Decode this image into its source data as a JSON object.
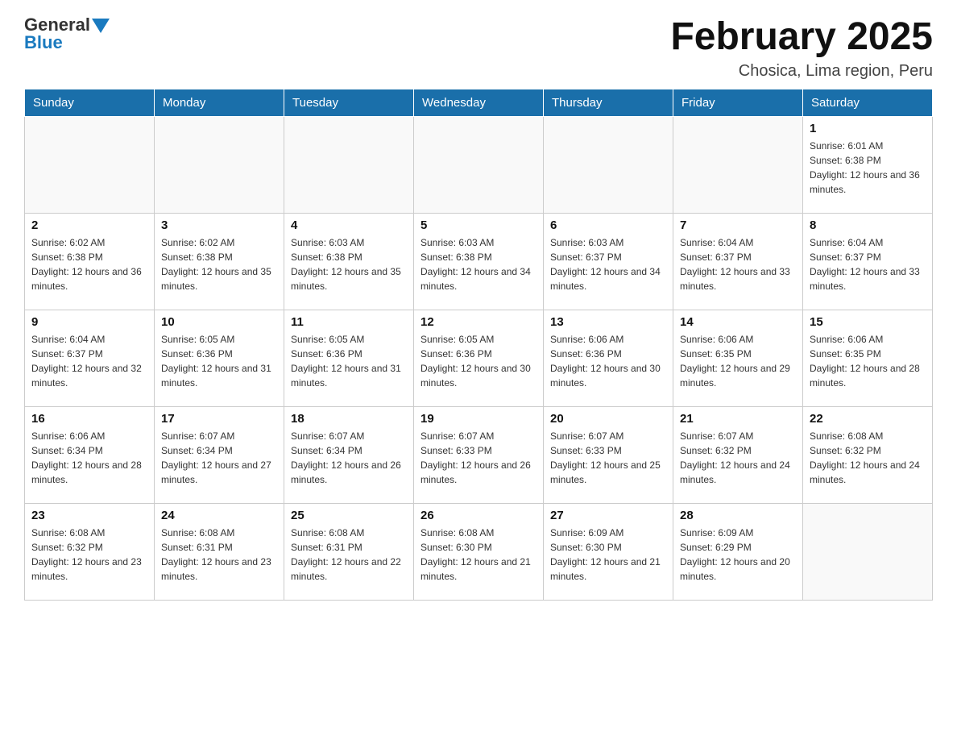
{
  "header": {
    "title": "February 2025",
    "subtitle": "Chosica, Lima region, Peru",
    "logo_general": "General",
    "logo_blue": "Blue"
  },
  "days_of_week": [
    "Sunday",
    "Monday",
    "Tuesday",
    "Wednesday",
    "Thursday",
    "Friday",
    "Saturday"
  ],
  "weeks": [
    [
      {
        "day": "",
        "info": ""
      },
      {
        "day": "",
        "info": ""
      },
      {
        "day": "",
        "info": ""
      },
      {
        "day": "",
        "info": ""
      },
      {
        "day": "",
        "info": ""
      },
      {
        "day": "",
        "info": ""
      },
      {
        "day": "1",
        "info": "Sunrise: 6:01 AM\nSunset: 6:38 PM\nDaylight: 12 hours and 36 minutes."
      }
    ],
    [
      {
        "day": "2",
        "info": "Sunrise: 6:02 AM\nSunset: 6:38 PM\nDaylight: 12 hours and 36 minutes."
      },
      {
        "day": "3",
        "info": "Sunrise: 6:02 AM\nSunset: 6:38 PM\nDaylight: 12 hours and 35 minutes."
      },
      {
        "day": "4",
        "info": "Sunrise: 6:03 AM\nSunset: 6:38 PM\nDaylight: 12 hours and 35 minutes."
      },
      {
        "day": "5",
        "info": "Sunrise: 6:03 AM\nSunset: 6:38 PM\nDaylight: 12 hours and 34 minutes."
      },
      {
        "day": "6",
        "info": "Sunrise: 6:03 AM\nSunset: 6:37 PM\nDaylight: 12 hours and 34 minutes."
      },
      {
        "day": "7",
        "info": "Sunrise: 6:04 AM\nSunset: 6:37 PM\nDaylight: 12 hours and 33 minutes."
      },
      {
        "day": "8",
        "info": "Sunrise: 6:04 AM\nSunset: 6:37 PM\nDaylight: 12 hours and 33 minutes."
      }
    ],
    [
      {
        "day": "9",
        "info": "Sunrise: 6:04 AM\nSunset: 6:37 PM\nDaylight: 12 hours and 32 minutes."
      },
      {
        "day": "10",
        "info": "Sunrise: 6:05 AM\nSunset: 6:36 PM\nDaylight: 12 hours and 31 minutes."
      },
      {
        "day": "11",
        "info": "Sunrise: 6:05 AM\nSunset: 6:36 PM\nDaylight: 12 hours and 31 minutes."
      },
      {
        "day": "12",
        "info": "Sunrise: 6:05 AM\nSunset: 6:36 PM\nDaylight: 12 hours and 30 minutes."
      },
      {
        "day": "13",
        "info": "Sunrise: 6:06 AM\nSunset: 6:36 PM\nDaylight: 12 hours and 30 minutes."
      },
      {
        "day": "14",
        "info": "Sunrise: 6:06 AM\nSunset: 6:35 PM\nDaylight: 12 hours and 29 minutes."
      },
      {
        "day": "15",
        "info": "Sunrise: 6:06 AM\nSunset: 6:35 PM\nDaylight: 12 hours and 28 minutes."
      }
    ],
    [
      {
        "day": "16",
        "info": "Sunrise: 6:06 AM\nSunset: 6:34 PM\nDaylight: 12 hours and 28 minutes."
      },
      {
        "day": "17",
        "info": "Sunrise: 6:07 AM\nSunset: 6:34 PM\nDaylight: 12 hours and 27 minutes."
      },
      {
        "day": "18",
        "info": "Sunrise: 6:07 AM\nSunset: 6:34 PM\nDaylight: 12 hours and 26 minutes."
      },
      {
        "day": "19",
        "info": "Sunrise: 6:07 AM\nSunset: 6:33 PM\nDaylight: 12 hours and 26 minutes."
      },
      {
        "day": "20",
        "info": "Sunrise: 6:07 AM\nSunset: 6:33 PM\nDaylight: 12 hours and 25 minutes."
      },
      {
        "day": "21",
        "info": "Sunrise: 6:07 AM\nSunset: 6:32 PM\nDaylight: 12 hours and 24 minutes."
      },
      {
        "day": "22",
        "info": "Sunrise: 6:08 AM\nSunset: 6:32 PM\nDaylight: 12 hours and 24 minutes."
      }
    ],
    [
      {
        "day": "23",
        "info": "Sunrise: 6:08 AM\nSunset: 6:32 PM\nDaylight: 12 hours and 23 minutes."
      },
      {
        "day": "24",
        "info": "Sunrise: 6:08 AM\nSunset: 6:31 PM\nDaylight: 12 hours and 23 minutes."
      },
      {
        "day": "25",
        "info": "Sunrise: 6:08 AM\nSunset: 6:31 PM\nDaylight: 12 hours and 22 minutes."
      },
      {
        "day": "26",
        "info": "Sunrise: 6:08 AM\nSunset: 6:30 PM\nDaylight: 12 hours and 21 minutes."
      },
      {
        "day": "27",
        "info": "Sunrise: 6:09 AM\nSunset: 6:30 PM\nDaylight: 12 hours and 21 minutes."
      },
      {
        "day": "28",
        "info": "Sunrise: 6:09 AM\nSunset: 6:29 PM\nDaylight: 12 hours and 20 minutes."
      },
      {
        "day": "",
        "info": ""
      }
    ]
  ]
}
